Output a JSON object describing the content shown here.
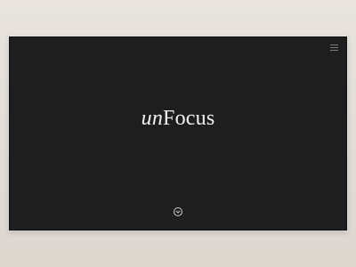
{
  "logo": {
    "prefix": "un",
    "name": "Focus"
  },
  "header": {
    "menu_icon": "hamburger-menu-icon"
  },
  "footer": {
    "scroll_icon": "circle-chevron-down-icon"
  },
  "colors": {
    "page_background": "#e4ded8",
    "window_background": "#1e1e1f",
    "text": "#f2f2f2",
    "icon": "#cfcfcf"
  }
}
